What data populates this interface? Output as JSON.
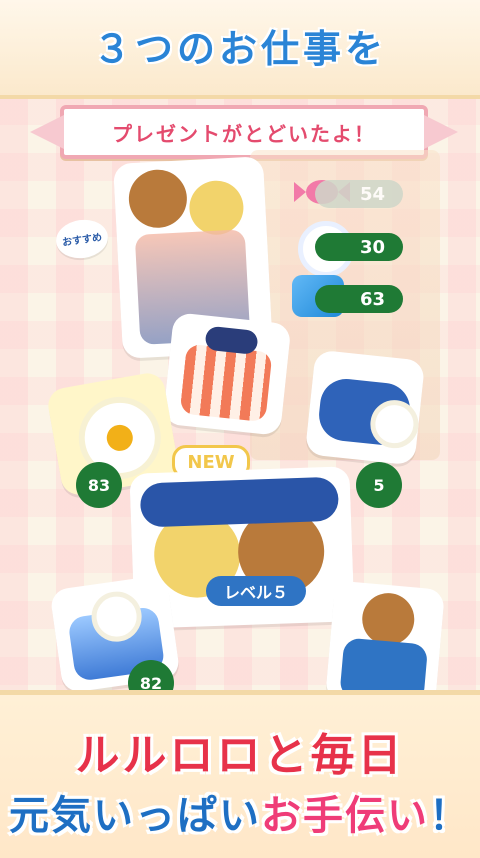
{
  "header": {
    "title": "３つのお仕事を"
  },
  "ribbon": {
    "text": "プレゼントがとどいたよ！"
  },
  "badge": {
    "label": "おすすめ"
  },
  "rewards": [
    {
      "value": "54",
      "icon": "candy-icon"
    },
    {
      "value": "30",
      "icon": "flower-icon"
    },
    {
      "value": "63",
      "icon": "ribbon-icon"
    }
  ],
  "items": {
    "new_label": "NEW",
    "level_label": "レベル５"
  },
  "counts": {
    "left_flower": "83",
    "right_hat": "5",
    "dress": "82"
  },
  "footer": {
    "line1": "ルルロロと毎日",
    "line2_prefix": "元気いっぱい",
    "line2_accent": "お手伝い",
    "line2_suffix": "！"
  }
}
